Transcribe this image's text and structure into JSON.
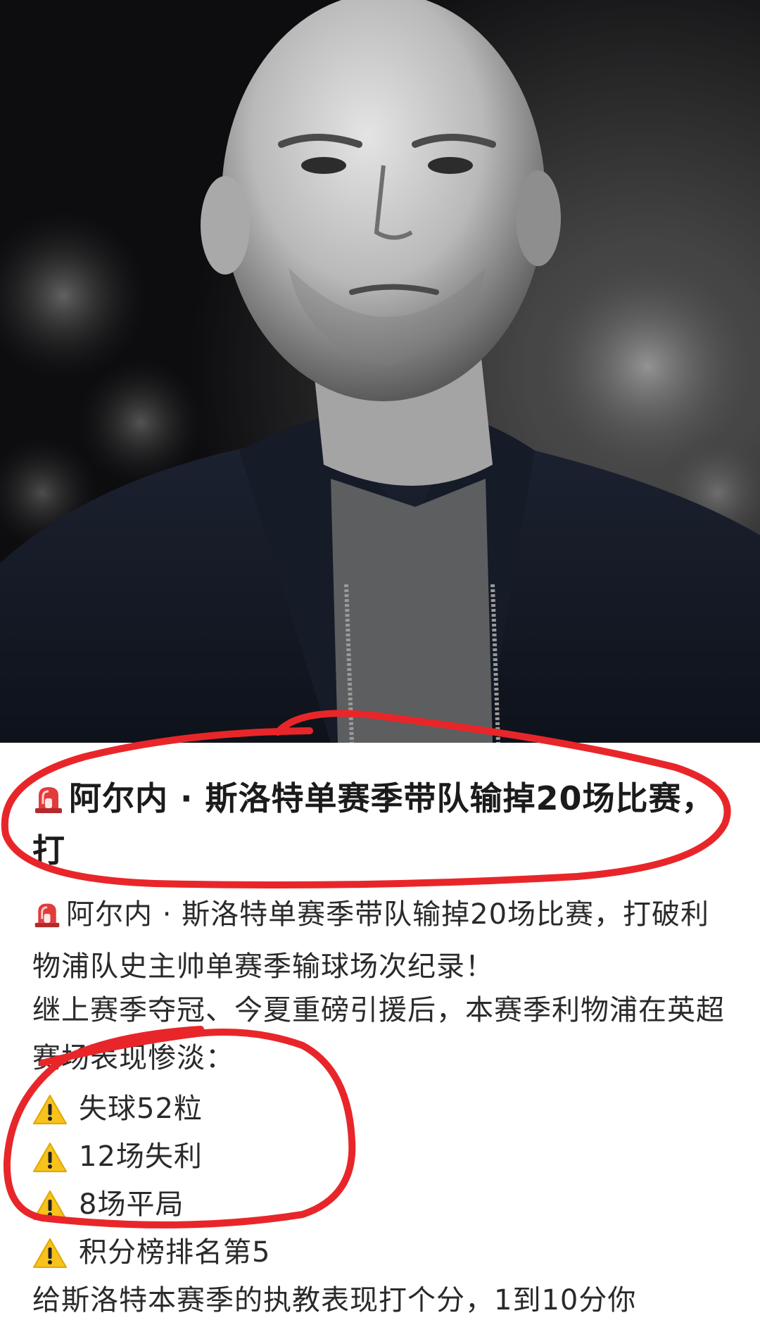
{
  "hero": {
    "image_alt": "Portrait of a bald man in a dark zip jacket, black and white background"
  },
  "post": {
    "headline_icon": "siren-icon",
    "headline": "阿尔内 · 斯洛特单赛季带队输掉20场比赛，打",
    "paragraph_1": "阿尔内 · 斯洛特单赛季带队输掉20场比赛，打破利物浦队史主帅单赛季输球场次纪录！",
    "paragraph_2": "继上赛季夺冠、今夏重磅引援后，本赛季利物浦在英超赛场表现惨淡：",
    "bullets": [
      {
        "icon": "warning-icon",
        "text": "失球52粒"
      },
      {
        "icon": "warning-icon",
        "text": "12场失利"
      },
      {
        "icon": "warning-icon",
        "text": "8场平局"
      },
      {
        "icon": "warning-icon",
        "text": "积分榜排名第5"
      }
    ],
    "paragraph_3": "给斯洛特本赛季的执教表现打个分，1到10分你"
  },
  "colors": {
    "annotation_red": "#e8262a",
    "text": "#2a2a2a",
    "siren_red": "#e23b3b",
    "warning_yellow": "#f7c21b"
  }
}
